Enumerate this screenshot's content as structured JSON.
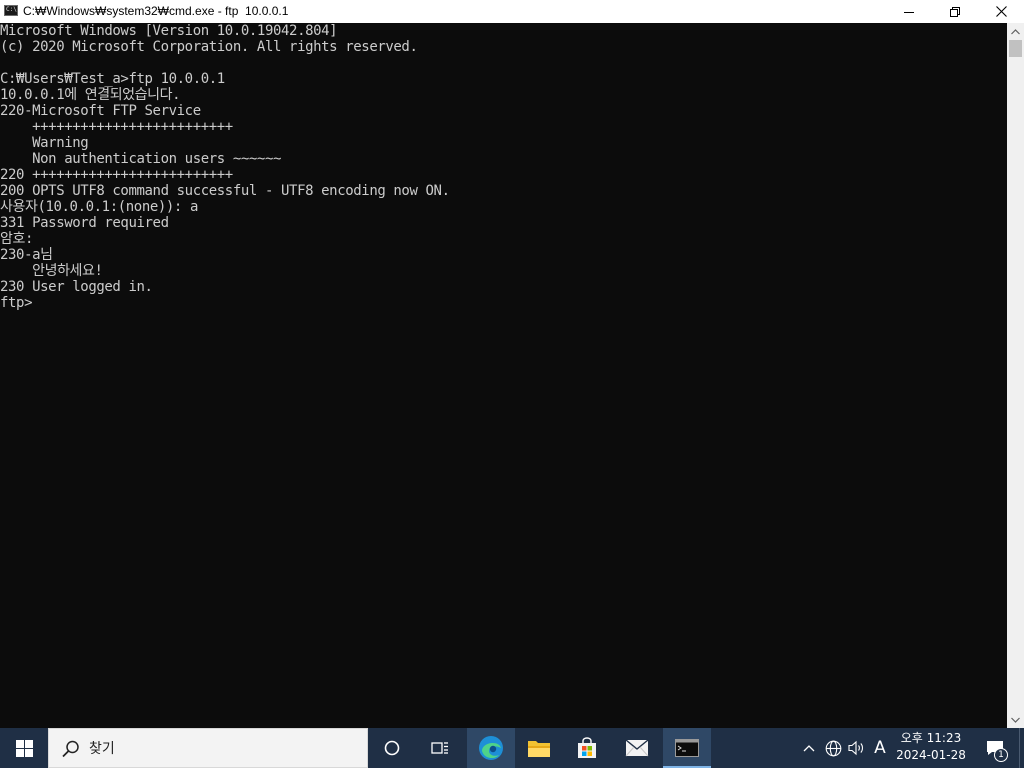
{
  "window": {
    "title": "C:₩Windows₩system32₩cmd.exe - ftp  10.0.0.1",
    "icon": "cmd-icon",
    "controls": [
      "minimize-icon",
      "maximize-icon",
      "close-icon"
    ]
  },
  "console": {
    "lines": [
      "Microsoft Windows [Version 10.0.19042.804]",
      "(c) 2020 Microsoft Corporation. All rights reserved.",
      "",
      "C:₩Users₩Test_a>ftp 10.0.0.1",
      "10.0.0.1에 연결되었습니다.",
      "220-Microsoft FTP Service",
      "    +++++++++++++++++++++++++",
      "    Warning",
      "    Non authentication users ~~~~~~",
      "220 +++++++++++++++++++++++++",
      "200 OPTS UTF8 command successful - UTF8 encoding now ON.",
      "사용자(10.0.0.1:(none)): a",
      "331 Password required",
      "암호:",
      "230-a님",
      "    안녕하세요!",
      "230 User logged in.",
      "ftp>"
    ]
  },
  "taskbar": {
    "search_placeholder": "찾기",
    "clock_time": "오후 11:23",
    "clock_date": "2024-01-28",
    "ime_indicator": "A",
    "notification_count": "1",
    "pinned": [
      "cortana-icon",
      "task-view-icon",
      "edge-icon",
      "file-explorer-icon",
      "store-icon",
      "mail-icon",
      "cmd-icon"
    ],
    "colors": {
      "bar": "#1f2f45",
      "active": "#2f4866"
    }
  },
  "colors": {
    "console_bg": "#0c0c0c",
    "console_text": "#cccccc"
  }
}
